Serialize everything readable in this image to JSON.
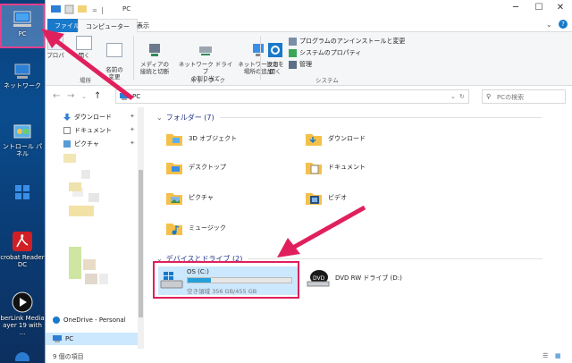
{
  "desktop": {
    "icons": [
      {
        "label": "PC"
      },
      {
        "label": "ネットワーク"
      },
      {
        "label": "ントロール パネル"
      },
      {
        "label": ""
      },
      {
        "label": "crobat Reader\nDC"
      },
      {
        "label": "berLink Media\nayer 19 with ..."
      }
    ]
  },
  "window": {
    "title": "PC",
    "tabs": {
      "file": "ファイル",
      "computer": "コンピューター",
      "view": "表示"
    },
    "ribbon": {
      "partial_left": [
        "プロパ",
        "開く",
        "名前の\n変更"
      ],
      "location_group": "場所",
      "network_buttons": [
        "メディアの\n接続と切断",
        "ネットワーク ドライブ\nの割り当て",
        "ネットワークの\n場所の追加"
      ],
      "network_group": "ネットワーク",
      "settings_button": "設定を\n開く",
      "system_items": [
        "プログラムのアンインストールと変更",
        "システムのプロパティ",
        "管理"
      ],
      "system_group": "システム"
    },
    "address": {
      "path": "PC",
      "search_placeholder": "PCの検索"
    },
    "nav": {
      "quick": [
        "ダウンロード",
        "ドキュメント",
        "ピクチャ"
      ],
      "onedrive": "OneDrive - Personal",
      "pc": "PC"
    },
    "folders": {
      "header": "フォルダー (7)",
      "items": [
        "3D オブジェクト",
        "ダウンロード",
        "デスクトップ",
        "ドキュメント",
        "ピクチャ",
        "ビデオ",
        "ミュージック"
      ]
    },
    "drives": {
      "header": "デバイスとドライブ (2)",
      "os": {
        "name": "OS (C:)",
        "free": "空き領域 356 GB/455 GB",
        "used_fraction": 0.22
      },
      "dvd": {
        "name": "DVD RW ドライブ (D:)"
      }
    },
    "status": "9 個の項目"
  },
  "colors": {
    "accent": "#1979ca",
    "highlight": "#e0205c",
    "selection": "#cce8ff"
  }
}
